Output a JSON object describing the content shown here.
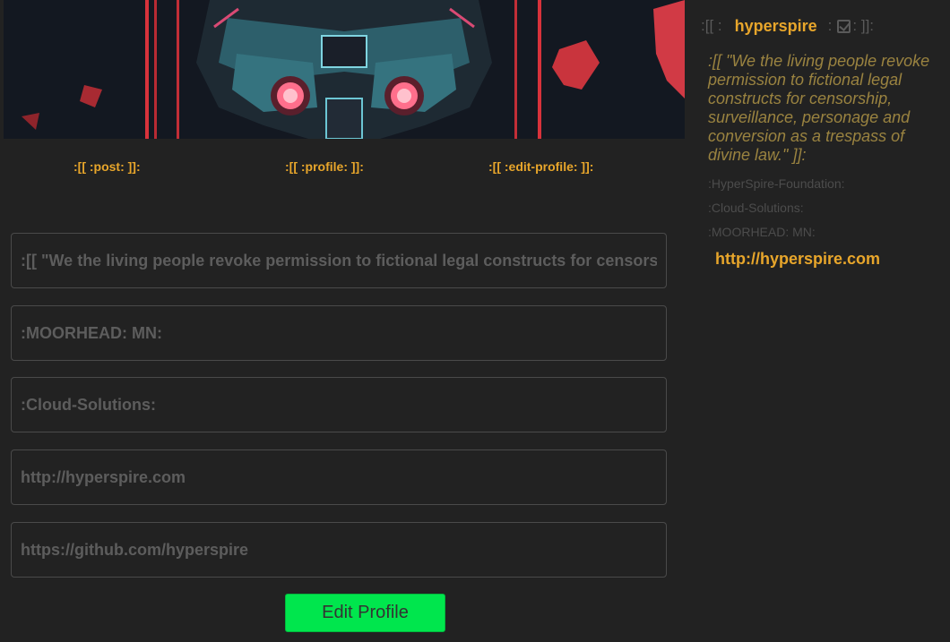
{
  "nav": {
    "post": ":[[ :post: ]]:",
    "profile": ":[[ :profile: ]]:",
    "edit_profile": ":[[ :edit-profile: ]]:"
  },
  "form": {
    "bio_placeholder": ":[[ \"We the living people revoke permission to fictional legal constructs for censorship, surveillance, personage and conversion as a trespass of divine law.\" ]]:",
    "location_placeholder": ":MOORHEAD: MN:",
    "company_placeholder": ":Cloud-Solutions:",
    "website_placeholder": "http://hyperspire.com",
    "github_placeholder": "https://github.com/hyperspire",
    "submit_label": "Edit Profile"
  },
  "profile": {
    "prefix": ":[[ :",
    "username": "hyperspire",
    "separator": ":",
    "suffix": ": ]]:",
    "bio": ":[[ \"We the living people revoke permission to fictional legal constructs for censorship, surveillance, personage and conversion as a trespass of divine law.\" ]]:",
    "organization": ":HyperSpire-Foundation:",
    "company": ":Cloud-Solutions:",
    "location": ":MOORHEAD: MN:",
    "website": "http://hyperspire.com"
  },
  "colors": {
    "background": "#222222",
    "accent": "#e8a62b",
    "button": "#00e64d"
  }
}
